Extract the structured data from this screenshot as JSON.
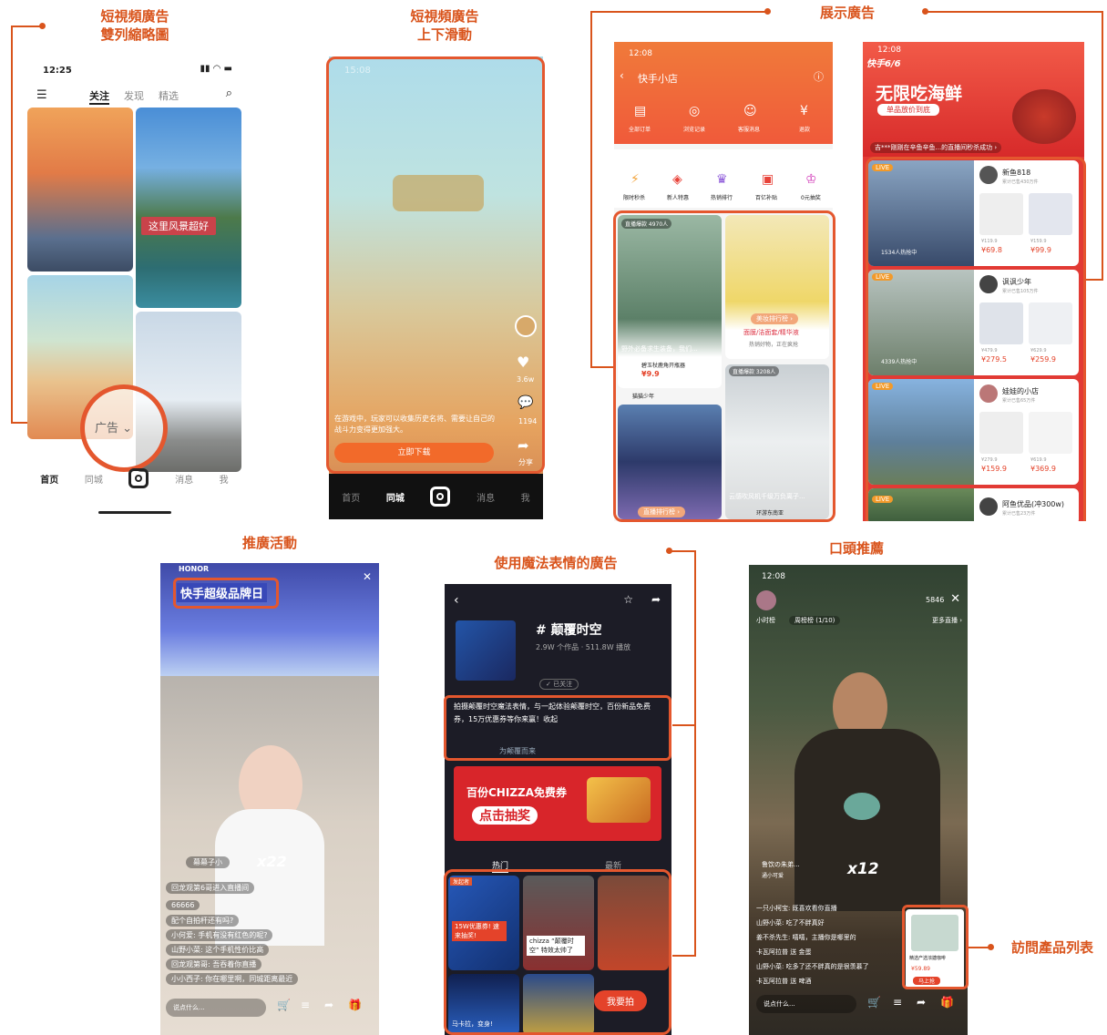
{
  "captions": {
    "c1_line1": "短視頻廣告",
    "c1_line2": "雙列縮略圖",
    "c2_line1": "短視頻廣告",
    "c2_line2": "上下滑動",
    "c3": "展示廣告",
    "c4": "推廣活動",
    "c5": "使用魔法表情的廣告",
    "c6": "口頭推薦",
    "c7": "訪問產品列表"
  },
  "phone1": {
    "time": "12:25",
    "tabs": [
      "关注",
      "发现",
      "精选"
    ],
    "overlay_text": "这里风景超好",
    "ad_label": "广告",
    "bottom_nav": [
      "首页",
      "同城",
      "消息",
      "我"
    ]
  },
  "phone2": {
    "time": "15:08",
    "ad_desc": "在游戏中，玩家可以收集历史名将、需要让自己的战斗力变得更加强大。",
    "download_button": "立即下载",
    "likes": "3.6w",
    "comments": "1194",
    "share": "分享",
    "bottom_nav": [
      "首页",
      "同城",
      "消息",
      "我"
    ]
  },
  "phone3": {
    "time": "12:08",
    "title": "快手小店",
    "icons_row1": [
      "全部订单",
      "浏览记录",
      "客服消息",
      "退款"
    ],
    "icons_row2": [
      "限时秒杀",
      "新人特惠",
      "热销排行",
      "百亿补贴",
      "0元抽奖"
    ],
    "card1_badge": "直播爆款 4970人",
    "card1_caption": "野外必备求生装备，我们...",
    "card1_tag": "碧玉杖鹿角开瓶器",
    "card1_price": "¥9.9",
    "card1_shop": "猫猫少年",
    "card2_tag": "美妆排行榜 ›",
    "card2_sub": "面膜/洁面套/精华液",
    "card2_sub2": "热销好物，正在疯抢",
    "card3_badge": "直播爆款 3208人",
    "card3_caption": "云感吹风机千级万负离子...",
    "card3_shop": "环游东南亚",
    "card4_tag": "直播排行榜 ›"
  },
  "phone4": {
    "time": "12:08",
    "brand": "快手6/6",
    "headline": "无限吃海鲜",
    "sub_button": "单品放价到底",
    "ticker": "吉***刚刚在辛鱼辛鱼...的直播间秒杀成功 ›",
    "live_label": "LIVE",
    "cards": [
      {
        "name": "新鱼818",
        "fans": "累计已售430万件",
        "viewers": "1534人热抢中",
        "p1": "¥69.8",
        "p2": "¥99.9",
        "o1": "¥119.9",
        "o2": "¥159.9"
      },
      {
        "name": "讽讽少年",
        "fans": "累计已售105万件",
        "viewers": "4339人热抢中",
        "p1": "¥279.5",
        "p2": "¥259.9",
        "o1": "¥479.9",
        "o2": "¥629.9"
      },
      {
        "name": "娃娃的小店",
        "fans": "累计已售65万件",
        "viewers": "",
        "p1": "¥159.9",
        "p2": "¥369.9",
        "o1": "¥279.9",
        "o2": "¥619.9"
      },
      {
        "name": "阿鱼优品(冲300w)",
        "fans": "累计已售23万件",
        "viewers": "",
        "p1": "",
        "p2": "",
        "o1": "",
        "o2": ""
      }
    ]
  },
  "phone5": {
    "banner_brand": "HONOR",
    "banner_title": "快手超级品牌日",
    "host_name": "幕幕子小",
    "gift_count": "x22",
    "comments": [
      "回龙观第6哥进入直播间",
      "66666",
      "配个自拍杆还有吗?",
      "小何爱: 手机有没有红色的呢?",
      "山野小菜: 这个手机性价比高",
      "回龙观第哥: 吾吞着你直播",
      "小小西子: 你在哪里啊，同城距离最近"
    ],
    "input_placeholder": "说点什么..."
  },
  "phone6": {
    "hashtag": "# 颠覆时空",
    "stats": "2.9W 个作品 · 511.8W 播放",
    "follow": "✓ 已关注",
    "desc": "拍摄颠覆时空魔法表情，与一起体验颠覆时空，百份新品免费券，15万优惠券等你来赢！收起",
    "link": "为颠覆而来",
    "coupon_text": "百份CHIZZA免费券",
    "coupon_button": "点击抽奖",
    "tab_hot": "热门",
    "tab_new": "最新",
    "launcher": "发起者",
    "cell_caption": "chizza “颠覆时空” 特效太帅了",
    "promo": "15W优惠券! 速来抽奖!",
    "shoot_button": "我要拍",
    "bottom_caption": "马卡拉，变身!"
  },
  "phone7": {
    "time": "12:08",
    "viewers": "5846",
    "more_live": "更多直播 ›",
    "rank": "周榜榜 (1/10)",
    "tag": "小时榜",
    "host_line": "鲁饮の朱弟...",
    "host_sub": "通小可爱",
    "gift_count": "x12",
    "comments": [
      "一只小柯宝: 既喜欢看你直播",
      "山野小菜: 吃了不胖真好",
      "姜不杀先生: 嘻嘻，主播你是哪里的",
      "卡瓦阿拉普 送 金蛋",
      "山野小菜: 吃多了还不胖真的是很羡慕了",
      "卡瓦阿拉普 送 啤酒"
    ],
    "product_name": "精选产选浓搪咖啡",
    "product_price": "¥59.89",
    "product_btn": "马上抢",
    "input_placeholder": "说点什么..."
  }
}
